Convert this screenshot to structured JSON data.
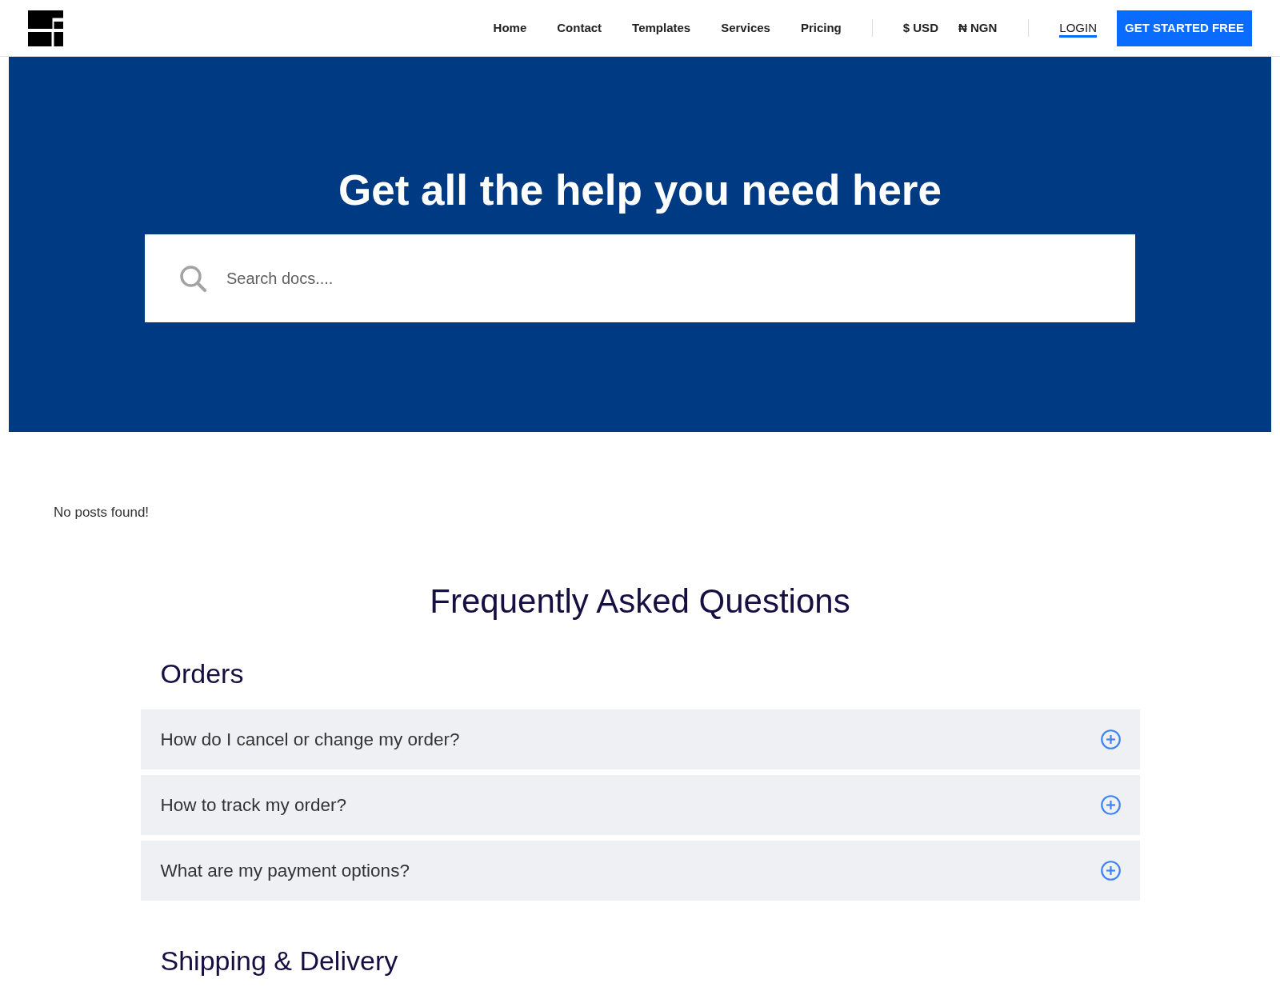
{
  "header": {
    "nav": [
      {
        "label": "Home"
      },
      {
        "label": "Contact"
      },
      {
        "label": "Templates"
      },
      {
        "label": "Services"
      },
      {
        "label": "Pricing"
      }
    ],
    "currencies": [
      {
        "label": "$ USD"
      },
      {
        "label": "₦ NGN"
      }
    ],
    "login": "LOGIN",
    "cta": "GET STARTED FREE"
  },
  "hero": {
    "title": "Get all the help you need here",
    "search": {
      "placeholder": "Search docs...."
    }
  },
  "posts_message": "No posts found!",
  "faq": {
    "title": "Frequently Asked Questions",
    "sections": [
      {
        "title": "Orders",
        "questions": [
          {
            "text": "How do I cancel or change my order?",
            "expanded": false
          },
          {
            "text": "How to track my order?",
            "expanded": false
          },
          {
            "text": "What are my payment options?",
            "expanded": false
          }
        ]
      },
      {
        "title": "Shipping & Delivery"
      }
    ]
  }
}
